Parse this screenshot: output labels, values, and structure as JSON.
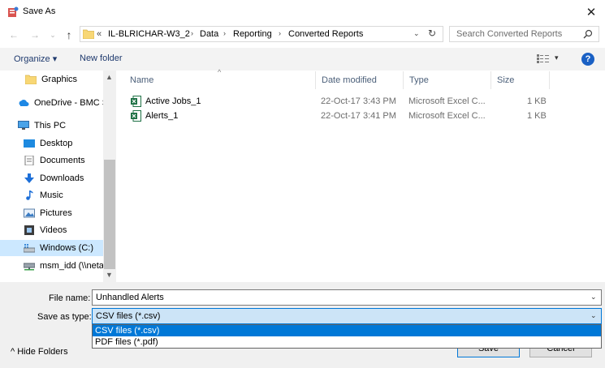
{
  "window": {
    "title": "Save As",
    "close_glyph": "✕"
  },
  "nav": {
    "back_glyph": "←",
    "forward_glyph": "→",
    "recent_glyph": "⌄",
    "up_glyph": "↑",
    "overflow": "«",
    "breadcrumbs": [
      "IL-BLRICHAR-W3_2",
      "Data",
      "Reporting",
      "Converted Reports"
    ],
    "separator": "›",
    "dropdown_glyph": "⌄",
    "refresh_glyph": "↻"
  },
  "search": {
    "placeholder": "Search Converted Reports",
    "icon": "search-icon"
  },
  "toolbar": {
    "organize": "Organize ▾",
    "new_folder": "New folder",
    "view_dropdown": "▾",
    "help": "?"
  },
  "sidebar": {
    "items": [
      {
        "label": "Graphics",
        "icon": "folder-icon"
      },
      {
        "label": "OneDrive - BMC S",
        "icon": "onedrive-icon"
      },
      {
        "label": "This PC",
        "icon": "pc-icon"
      },
      {
        "label": "Desktop",
        "icon": "desktop-icon"
      },
      {
        "label": "Documents",
        "icon": "documents-icon"
      },
      {
        "label": "Downloads",
        "icon": "downloads-icon"
      },
      {
        "label": "Music",
        "icon": "music-icon"
      },
      {
        "label": "Pictures",
        "icon": "pictures-icon"
      },
      {
        "label": "Videos",
        "icon": "videos-icon"
      },
      {
        "label": "Windows (C:)",
        "icon": "drive-icon",
        "selected": true
      },
      {
        "label": "msm_idd (\\\\neta",
        "icon": "network-drive-icon"
      }
    ],
    "scroll_up": "▲",
    "scroll_down": "▼"
  },
  "file_list": {
    "columns": [
      "Name",
      "Date modified",
      "Type",
      "Size"
    ],
    "sort_glyph": "^",
    "rows": [
      {
        "name": "Active Jobs_1",
        "date": "22-Oct-17 3:43 PM",
        "type": "Microsoft Excel C...",
        "size": "1 KB"
      },
      {
        "name": "Alerts_1",
        "date": "22-Oct-17 3:41 PM",
        "type": "Microsoft Excel C...",
        "size": "1 KB"
      }
    ]
  },
  "form": {
    "file_name_label": "File name:",
    "file_name_value": "Unhandled Alerts",
    "save_as_type_label": "Save as type:",
    "save_as_type_value": "CSV files (*.csv)",
    "dropdown_glyph": "⌄",
    "type_options": [
      "CSV files (*.csv)",
      "PDF files (*.pdf)"
    ],
    "hide_folders": "^  Hide Folders",
    "save_button": "Save",
    "cancel_button": "Cancel"
  },
  "colors": {
    "selection": "#cce8ff",
    "accent": "#0078d7",
    "folder": "#f8d775",
    "excel": "#1e7145",
    "help": "#1a60c4"
  }
}
